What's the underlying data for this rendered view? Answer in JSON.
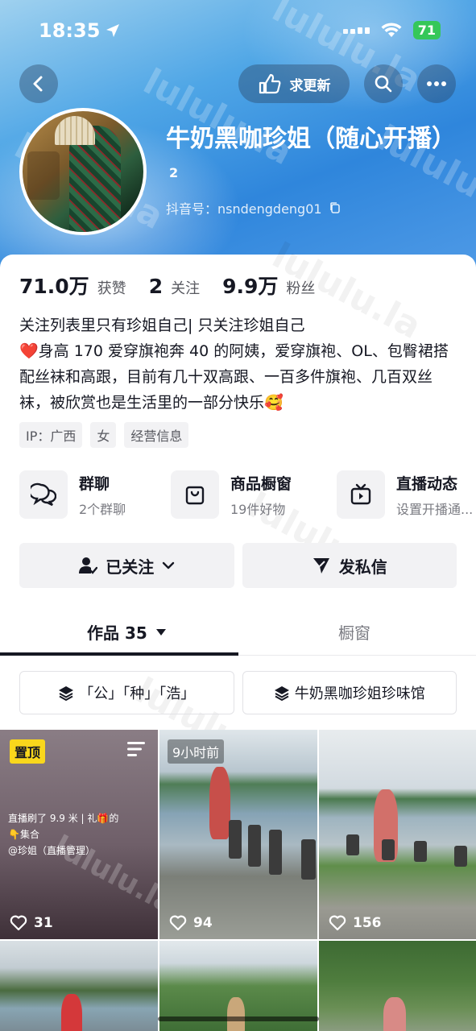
{
  "status_bar": {
    "time": "18:35",
    "battery": "71"
  },
  "top_actions": {
    "request_update_label": "求更新"
  },
  "profile": {
    "name": "牛奶黑咖珍姐（随心开播）",
    "name_badge": "2",
    "douyin_id": "抖音号：nsndengdeng01"
  },
  "stats": [
    {
      "value": "71.0万",
      "label": "获赞"
    },
    {
      "value": "2",
      "label": "关注"
    },
    {
      "value": "9.9万",
      "label": "粉丝"
    }
  ],
  "bio": {
    "line1": "关注列表里只有珍姐自己| 只关注珍姐自己",
    "heart": "❤️",
    "line2": "身高 170 爱穿旗袍奔 40 的阿姨，爱穿旗袍、OL、包臀裙搭配丝袜和高跟，目前有几十双高跟、一百多件旗袍、几百双丝袜，被欣赏也是生活里的一部分快乐",
    "emoji": "🥰"
  },
  "tags": [
    "IP：广西",
    "女",
    "经营信息"
  ],
  "features": [
    {
      "title": "群聊",
      "subtitle": "2个群聊",
      "icon": "chat-bubbles-icon"
    },
    {
      "title": "商品橱窗",
      "subtitle": "19件好物",
      "icon": "shopping-bag-icon"
    },
    {
      "title": "直播动态",
      "subtitle": "设置开播通...",
      "icon": "tv-icon"
    }
  ],
  "action_buttons": {
    "followed": "已关注",
    "message": "发私信"
  },
  "tabs": {
    "works": "作品 35",
    "shop": "橱窗"
  },
  "collections": [
    "「公」「种」「浩」",
    "牛奶黑咖珍姐珍味馆"
  ],
  "videos": [
    {
      "badge": "置顶",
      "caption_line1": "直播刷了 9.9 米 | 礼🎁的",
      "caption_line2": "👇集合",
      "caption_line3": "@珍姐（直播管理）",
      "likes": "31"
    },
    {
      "badge": "9小时前",
      "likes": "94"
    },
    {
      "likes": "156"
    }
  ],
  "watermark": "lululu.la"
}
